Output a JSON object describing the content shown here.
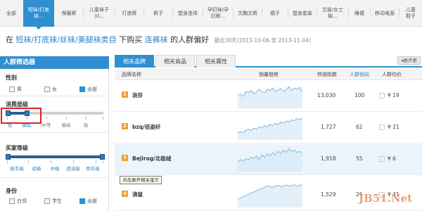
{
  "nav": {
    "items": [
      "全部",
      "短袜/打底\n袜...",
      "保暖裤",
      "儿童袜子\n(0...",
      "打底裤",
      "裤子",
      "塑身连体",
      "孕妇袜/孕\n妇裤...",
      "文胸文裤",
      "裙子",
      "塑身套装",
      "文装/女士\n棉...",
      "睡裙",
      "移动电源",
      "儿童\n鞋子"
    ]
  },
  "headline": {
    "prefix": "在",
    "categories": "短袜/打底袜/丝袜/美腿袜类目",
    "middle": "下购买",
    "product": "连裤袜",
    "suffix": "的人群偏好",
    "range": "最近30天(2013-10-06 至 2013-11-04)"
  },
  "filter": {
    "title": "人群筛选器",
    "gender": {
      "title": "性别",
      "options": [
        "男",
        "女",
        "全部"
      ],
      "checked": [
        false,
        false,
        true
      ]
    },
    "consumption": {
      "title": "消费层级",
      "labels": [
        "低",
        "偏低",
        "中等",
        "偏高",
        "高"
      ],
      "range_index": [
        0,
        1
      ]
    },
    "buyer_level": {
      "title": "买家等级",
      "labels": [
        "新手级",
        "初级",
        "中级",
        "资深级",
        "骨灰级"
      ],
      "range_index": [
        0,
        4
      ]
    },
    "identity": {
      "title": "身份",
      "options": [
        "白领",
        "学生",
        "全部"
      ],
      "checked": [
        false,
        false,
        true
      ]
    }
  },
  "tabs": {
    "items": [
      "相关品牌",
      "相关商品",
      "相关属性"
    ],
    "active": 0,
    "export_label": "◂展开更"
  },
  "table": {
    "headers": {
      "name": "品牌名称",
      "trend": "销量趋势",
      "heat": "热销指数",
      "tilt": "人群倾向",
      "price": "人群均价"
    },
    "rows": [
      {
        "rank": "1",
        "name": "浪莎",
        "heat": "13,030",
        "tilt": "100",
        "price": "¥ 19",
        "trend": [
          0.55,
          0.6,
          0.5,
          0.7,
          0.65,
          0.75,
          0.6,
          0.7,
          0.8,
          0.7,
          0.65,
          0.8,
          0.75,
          0.85,
          0.7,
          0.78,
          0.82,
          0.7,
          0.8,
          0.9,
          0.75,
          0.85,
          0.8,
          0.88,
          0.7
        ]
      },
      {
        "rank": "2",
        "name": "bzq/佰姿纤",
        "heat": "1,727",
        "tilt": "62",
        "price": "¥ 21",
        "trend": [
          0.3,
          0.35,
          0.3,
          0.4,
          0.45,
          0.4,
          0.5,
          0.45,
          0.55,
          0.5,
          0.6,
          0.55,
          0.65,
          0.6,
          0.7,
          0.65,
          0.75,
          0.7,
          0.8,
          0.75,
          0.85,
          0.8,
          0.9,
          0.85,
          0.92
        ]
      },
      {
        "rank": "3",
        "name": "Bejirog/北极绒",
        "heat": "1,918",
        "tilt": "55",
        "price": "¥ 6",
        "trend": [
          0.4,
          0.5,
          0.45,
          0.55,
          0.5,
          0.6,
          0.55,
          0.65,
          0.5,
          0.7,
          0.6,
          0.75,
          0.65,
          0.8,
          0.7,
          0.85,
          0.75,
          0.9,
          0.8,
          0.95,
          0.85,
          0.9,
          0.8,
          0.85,
          0.75
        ]
      },
      {
        "rank": "4",
        "name": "沸鼠",
        "heat": "1,529",
        "tilt": "26",
        "price": "¥ 31",
        "trend": [
          0.35,
          0.4,
          0.45,
          0.5,
          0.55,
          0.6,
          0.65,
          0.7,
          0.75,
          0.8,
          0.85,
          0.9,
          0.88,
          0.85,
          0.9,
          0.92,
          0.88,
          0.9,
          0.94,
          0.9,
          0.92,
          0.95,
          0.9,
          0.93,
          0.95
        ]
      }
    ],
    "highlight_row": 2,
    "tooltip": "点击展开相关宝贝"
  },
  "watermark": "JB51.Net",
  "colors": {
    "accent": "#2f8fd0",
    "rank": "#f0a030",
    "highlight_text": "#2a7fc0",
    "trend": "#7fb8e0",
    "red_box": "#e02020"
  }
}
